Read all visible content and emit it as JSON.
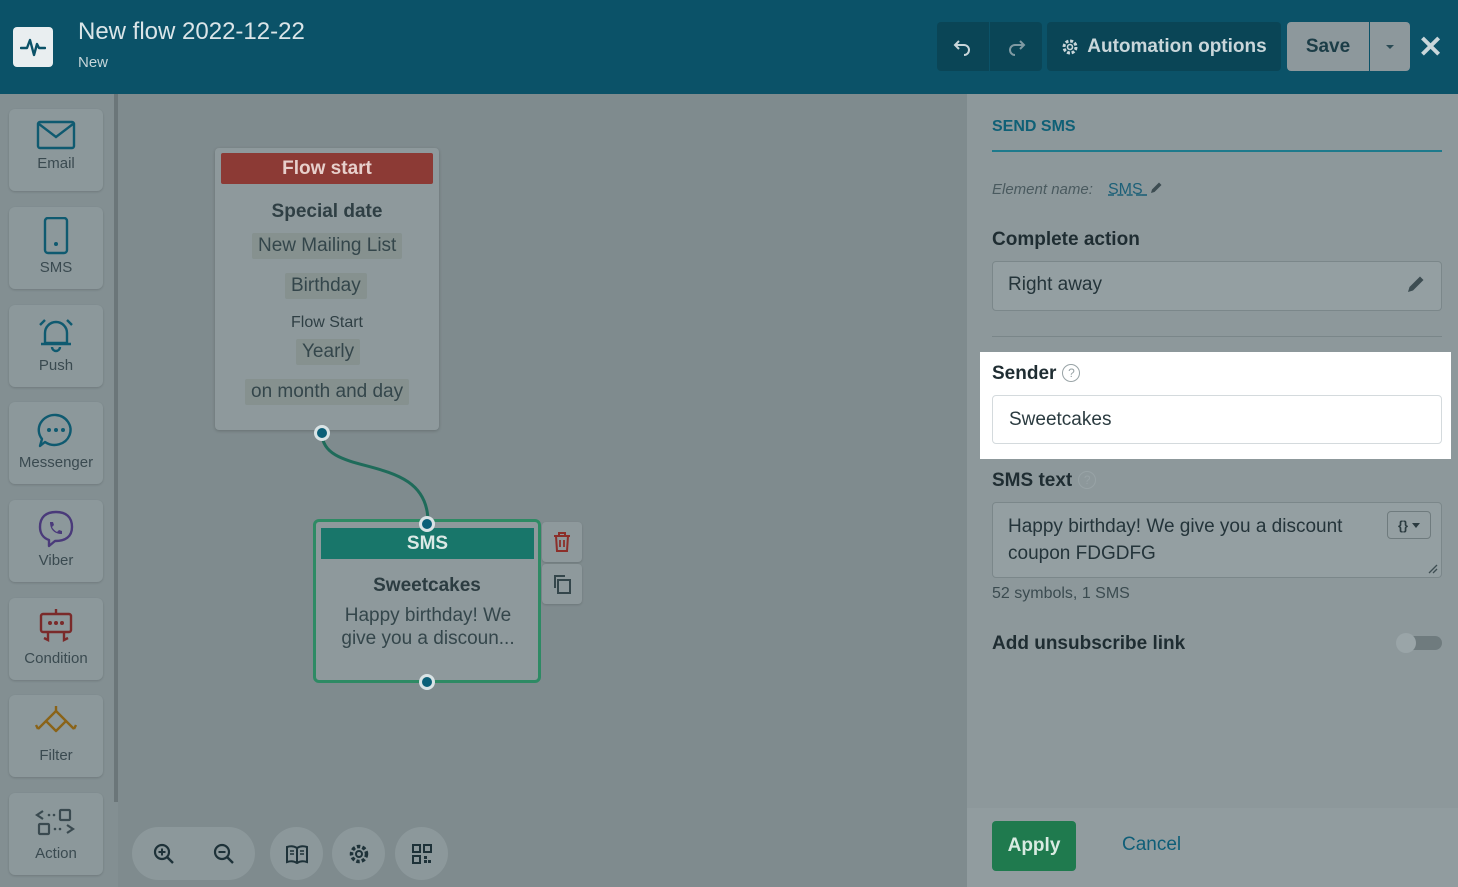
{
  "header": {
    "title": "New flow 2022-12-22",
    "status": "New",
    "automation_options_label": "Automation options",
    "save_label": "Save",
    "close_glyph": "✕"
  },
  "toolbar": {
    "items": [
      {
        "label": "Email",
        "icon": "envelope-icon"
      },
      {
        "label": "SMS",
        "icon": "phone-icon"
      },
      {
        "label": "Push",
        "icon": "bell-icon"
      },
      {
        "label": "Messenger",
        "icon": "chat-icon"
      },
      {
        "label": "Viber",
        "icon": "viber-icon"
      },
      {
        "label": "Condition",
        "icon": "condition-icon"
      },
      {
        "label": "Filter",
        "icon": "filter-icon"
      },
      {
        "label": "Action",
        "icon": "action-icon"
      }
    ]
  },
  "canvas": {
    "start_node": {
      "header": "Flow start",
      "trigger": "Special date",
      "list": "New Mailing List",
      "field": "Birthday",
      "subheading": "Flow Start",
      "frequency": "Yearly",
      "match": "on month and day"
    },
    "sms_node": {
      "header": "SMS",
      "sender": "Sweetcakes",
      "preview": "Happy birthday! We give you a discoun..."
    }
  },
  "panel": {
    "title": "SEND SMS",
    "element_name_label": "Element name:",
    "element_name_value": "SMS",
    "complete_action_label": "Complete action",
    "complete_action_value": "Right away",
    "sender_label": "Sender",
    "sender_value": "Sweetcakes",
    "sms_text_label": "SMS text",
    "sms_text_value": "Happy birthday! We give you a discount coupon FDGDFG",
    "variables_glyph": "{}",
    "counter": "52 symbols, 1 SMS",
    "unsubscribe_label": "Add unsubscribe link",
    "unsubscribe_enabled": false,
    "apply_label": "Apply",
    "cancel_label": "Cancel"
  },
  "colors": {
    "header_bg": "#0b5268",
    "start_header": "#8c3a35",
    "sms_header": "#18766a",
    "apply": "#1f7a4e",
    "accent": "#0f6076"
  }
}
